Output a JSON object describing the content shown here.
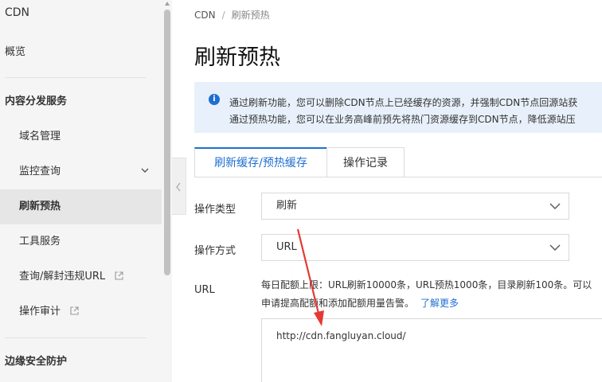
{
  "sidebar": {
    "title": "CDN",
    "overview": "概览",
    "section_distribution": "内容分发服务",
    "items": [
      {
        "label": "域名管理"
      },
      {
        "label": "监控查询"
      },
      {
        "label": "刷新预热"
      },
      {
        "label": "工具服务"
      },
      {
        "label": "查询/解封违规URL"
      },
      {
        "label": "操作审计"
      }
    ],
    "section_security": "边缘安全防护"
  },
  "breadcrumb": {
    "root": "CDN",
    "separator": "/",
    "current": "刷新预热"
  },
  "page": {
    "title": "刷新预热"
  },
  "notice": {
    "line1": "通过刷新功能，您可以删除CDN节点上已经缓存的资源，并强制CDN节点回源站获",
    "line2": "通过预热功能，您可以在业务高峰前预先将热门资源缓存到CDN节点，降低源站压"
  },
  "tabs": [
    {
      "label": "刷新缓存/预热缓存",
      "active": true
    },
    {
      "label": "操作记录",
      "active": false
    }
  ],
  "form": {
    "op_type_label": "操作类型",
    "op_type_value": "刷新",
    "op_method_label": "操作方式",
    "op_method_value": "URL",
    "url_label": "URL",
    "quota_line1": "每日配额上限：URL刷新10000条，URL预热1000条，目录刷新100条。可以",
    "quota_line2": "申请提高配额和添加配额用量告警。",
    "learn_more": "了解更多",
    "url_value": "http://cdn.fangluyan.cloud/"
  },
  "colors": {
    "accent": "#1f6fd1",
    "annotation": "#e53935",
    "notice_bg": "#e8f1fb"
  },
  "icons": [
    "info-icon",
    "chevron-down-icon",
    "external-link-icon",
    "chevron-left-icon"
  ]
}
